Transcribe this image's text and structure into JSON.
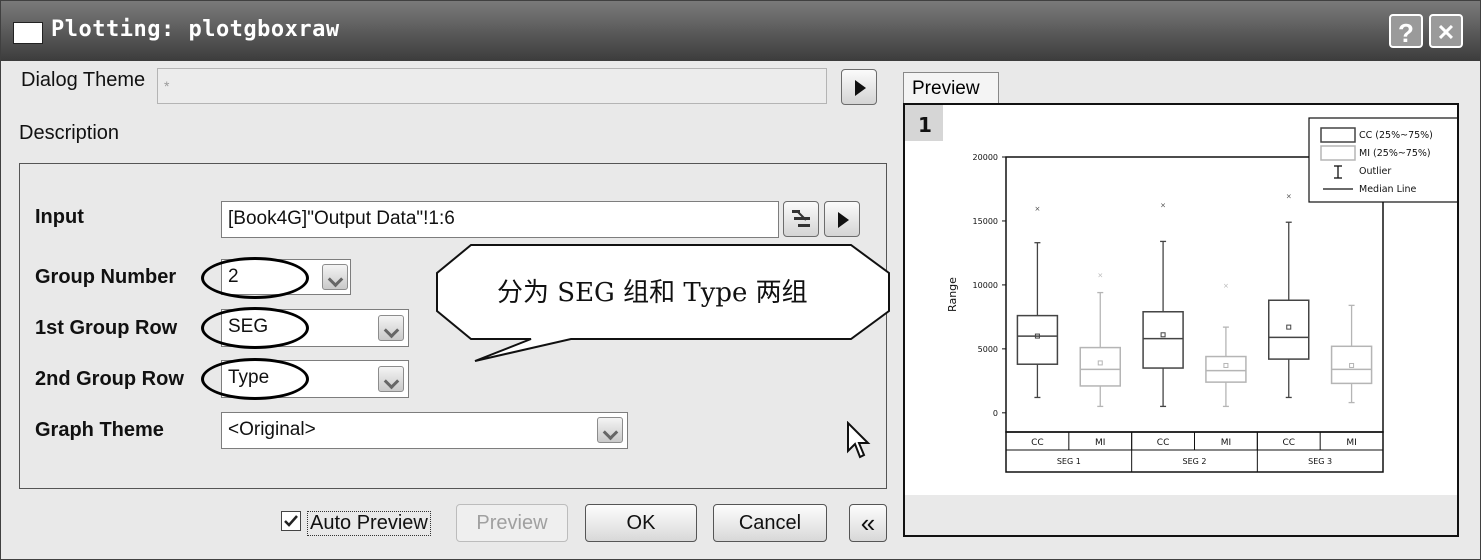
{
  "window": {
    "title": "Plotting: plotgboxraw",
    "help_label": "?",
    "close_label": "✕"
  },
  "dialog_theme": {
    "label": "Dialog Theme",
    "value": "*"
  },
  "description_label": "Description",
  "form": {
    "input_label": "Input",
    "input_value": "[Book4G]\"Output Data\"!1:6",
    "group_number_label": "Group Number",
    "group_number_value": "2",
    "first_group_row_label": "1st Group Row",
    "first_group_row_value": "SEG",
    "second_group_row_label": "2nd Group Row",
    "second_group_row_value": "Type",
    "graph_theme_label": "Graph Theme",
    "graph_theme_value": "<Original>"
  },
  "callout_text": "分为 SEG 组和 Type 两组",
  "footer": {
    "auto_preview_label": "Auto Preview",
    "auto_preview_checked": true,
    "preview_button": "Preview",
    "ok_button": "OK",
    "cancel_button": "Cancel",
    "collapse_label": "«"
  },
  "preview_tab": "Preview",
  "chart_data": {
    "type": "box",
    "layer_number": "1",
    "ylabel": "Range",
    "ylim": [
      -1500,
      20000
    ],
    "yticks": [
      0,
      5000,
      10000,
      15000,
      20000
    ],
    "series_colors": {
      "CC": "#444444",
      "MI": "#b5b5b5"
    },
    "x_labels_row1": [
      "CC",
      "MI",
      "CC",
      "MI",
      "CC",
      "MI"
    ],
    "x_labels_row2": [
      "SEG 1",
      "SEG 2",
      "SEG 3"
    ],
    "legend": [
      "CC (25%~75%)",
      "MI (25%~75%)",
      "Outlier",
      "Median Line"
    ],
    "boxes": [
      {
        "group": "SEG 1",
        "type": "CC",
        "min": 1200,
        "q1": 3800,
        "median": 6000,
        "mean": 6000,
        "q3": 7600,
        "max": 13300,
        "outlier": 16000
      },
      {
        "group": "SEG 1",
        "type": "MI",
        "min": 500,
        "q1": 2100,
        "median": 3400,
        "mean": 3900,
        "q3": 5100,
        "max": 9400,
        "outlier": 10800
      },
      {
        "group": "SEG 2",
        "type": "CC",
        "min": 500,
        "q1": 3500,
        "median": 5800,
        "mean": 6100,
        "q3": 7900,
        "max": 13400,
        "outlier": 16300
      },
      {
        "group": "SEG 2",
        "type": "MI",
        "min": 500,
        "q1": 2400,
        "median": 3300,
        "mean": 3700,
        "q3": 4400,
        "max": 6700,
        "outlier": 10000
      },
      {
        "group": "SEG 3",
        "type": "CC",
        "min": 1200,
        "q1": 4200,
        "median": 5900,
        "mean": 6700,
        "q3": 8800,
        "max": 14900,
        "outlier": 17000
      },
      {
        "group": "SEG 3",
        "type": "MI",
        "min": 800,
        "q1": 2300,
        "median": 3400,
        "mean": 3700,
        "q3": 5200,
        "max": 8400,
        "outlier": null
      }
    ]
  }
}
